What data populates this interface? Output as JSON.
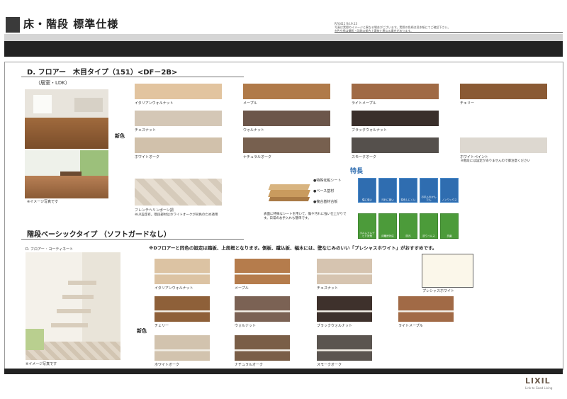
{
  "header": {
    "title": "床・階段 標準仕様",
    "notes": [
      "RF0411  R4.9.13",
      "写真は実際のイメージと異なる場合がございます。実際の色柄は見本帳にてご確認下さい。",
      "※色や柄は撮影・印刷の都合上実物と異なる場合があります。"
    ]
  },
  "floor": {
    "heading": "D. フロアー　木目タイプ（151）<DF－2B>",
    "room_caption": "（居室・LDK）",
    "photo_caption": "※イメージ写真です",
    "new_color_label": "新色",
    "swatches": [
      {
        "label": "イタリアンウォルナット",
        "color": "#e2c49f"
      },
      {
        "label": "メープル",
        "color": "#b07a49"
      },
      {
        "label": "ライトメープル",
        "color": "#a06a45"
      },
      {
        "label": "チェリー",
        "color": "#8a5a34"
      },
      {
        "label": "チェスナット",
        "color": "#d4c7b6"
      },
      {
        "label": "ウォルナット",
        "color": "#6c564a"
      },
      {
        "label": "ブラックウォルナット",
        "color": "#3a2f2b"
      },
      {
        "label": "ホワイトオーク",
        "color": "#d1c1ab"
      },
      {
        "label": "ナチュラルオーク",
        "color": "#77604f"
      },
      {
        "label": "スモークオーク",
        "color": "#55504c"
      },
      {
        "label": "ホワイトペイント",
        "color": "#ddd8d0"
      }
    ],
    "herringbone": {
      "label": "フレンチヘリンボーン調",
      "note": "※LR設定有。階段部材はホワイトオークが同色のため適用"
    },
    "whitepaint_note": "※階段には設定がありませんので御注意ください",
    "features": {
      "title": "特長",
      "layers": [
        "●特殊化粧シート",
        "●ベース基材",
        "●複合基材合板"
      ],
      "description": "表面に特殊なシートを用いて、傷や汚れに強い仕上がりです。日常のお手入れも簡単です。",
      "icons": [
        {
          "label": "傷に強い",
          "color": "#2f6db0"
        },
        {
          "label": "汚れに強い",
          "color": "#2f6db0"
        },
        {
          "label": "変色しにくい",
          "color": "#2f6db0"
        },
        {
          "label": "お手入れかんたん",
          "color": "#2f6db0"
        },
        {
          "label": "ノンワックス",
          "color": "#2f6db0"
        },
        {
          "label": "ホルムアルデヒド対策",
          "color": "#4c9b3a"
        },
        {
          "label": "床暖房対応",
          "color": "#4c9b3a"
        },
        {
          "label": "防汚",
          "color": "#4c9b3a"
        },
        {
          "label": "抗ウイルス",
          "color": "#4c9b3a"
        },
        {
          "label": "抗菌",
          "color": "#4c9b3a"
        }
      ]
    }
  },
  "stairs": {
    "heading": "階段ベーシックタイプ （ソフトガードなし）",
    "photo_title": "D. フロアー ･ ヨーティネート",
    "photo_caption": "※イメージ写真です",
    "note": "※Dフロアーと同色の設定は踏板、上段框となります。側板、蹴込板、幅木には、壁なじみのいい「プレシャスホワイト」がおすすめです。",
    "new_color_label": "新色",
    "swatches": [
      {
        "label": "イタリアンウォルナット",
        "color": "#dcc3a3"
      },
      {
        "label": "メープル",
        "color": "#b57c4c"
      },
      {
        "label": "チェスナット",
        "color": "#d6c4b0"
      },
      {
        "label": "チェリー",
        "color": "#8e6039"
      },
      {
        "label": "ウォルナット",
        "color": "#7b6254"
      },
      {
        "label": "ブラックウォルナット",
        "color": "#3e312c"
      },
      {
        "label": "ライトメープル",
        "color": "#a16a46"
      },
      {
        "label": "ホワイトオーク",
        "color": "#d2c3ae"
      },
      {
        "label": "ナチュラルオーク",
        "color": "#7a5e47"
      },
      {
        "label": "スモークオーク",
        "color": "#5b5550"
      }
    ],
    "precious_white": {
      "label": "プレシャスホワイト",
      "color": "#fbf7ea"
    }
  },
  "footer": {
    "logo": "LIXIL",
    "tagline": "Link to Good Living"
  }
}
